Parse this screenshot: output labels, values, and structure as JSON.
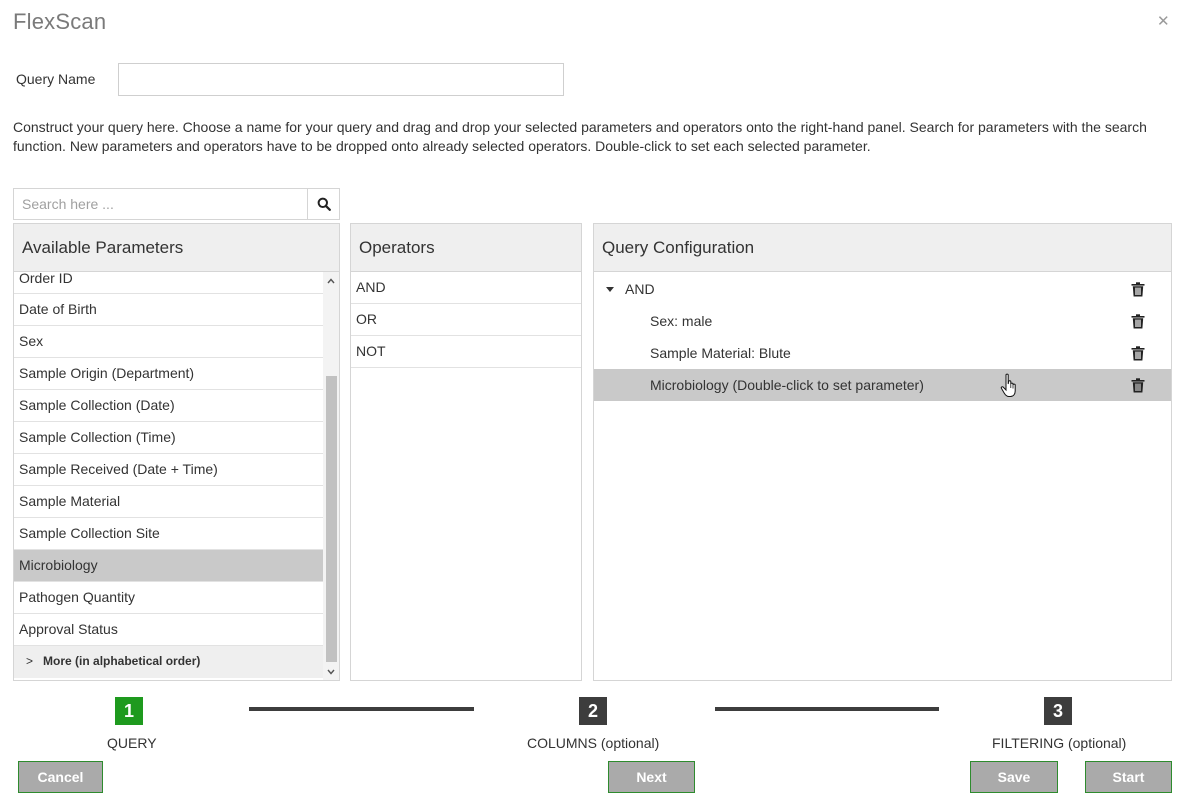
{
  "header": {
    "title": "FlexScan",
    "close_glyph": "✕"
  },
  "query_name": {
    "label": "Query Name",
    "value": "",
    "placeholder": ""
  },
  "instructions": "Construct your query here. Choose a name for your query and drag and drop your selected parameters and operators onto the right-hand panel. Search for parameters with the search function. New parameters and operators have to be dropped onto already selected operators. Double-click to set each selected parameter.",
  "search": {
    "placeholder": "Search here ...",
    "icon": "search-icon"
  },
  "available_parameters": {
    "title": "Available Parameters",
    "items": [
      "Order ID",
      "Date of Birth",
      "Sex",
      "Sample Origin (Department)",
      "Sample Collection (Date)",
      "Sample Collection (Time)",
      "Sample Received (Date + Time)",
      "Sample Material",
      "Sample Collection Site",
      "Microbiology",
      "Pathogen Quantity",
      "Approval Status"
    ],
    "selected": "Microbiology",
    "more_label": "More (in alphabetical order)"
  },
  "operators": {
    "title": "Operators",
    "items": [
      "AND",
      "OR",
      "NOT"
    ]
  },
  "query_configuration": {
    "title": "Query Configuration",
    "root": "AND",
    "children": [
      "Sex: male",
      "Sample Material: Blute",
      "Microbiology (Double-click to set parameter)"
    ]
  },
  "steps": [
    {
      "number": "1",
      "label": "QUERY",
      "active": true
    },
    {
      "number": "2",
      "label": "COLUMNS (optional)",
      "active": false
    },
    {
      "number": "3",
      "label": "FILTERING (optional)",
      "active": false
    }
  ],
  "buttons": {
    "cancel": "Cancel",
    "next": "Next",
    "save": "Save",
    "start": "Start"
  },
  "colors": {
    "accent_green": "#1e9a1e",
    "step_inactive": "#3d3d3d",
    "selected_row": "#c9c9c9",
    "button_grey": "#aaaaaa"
  }
}
